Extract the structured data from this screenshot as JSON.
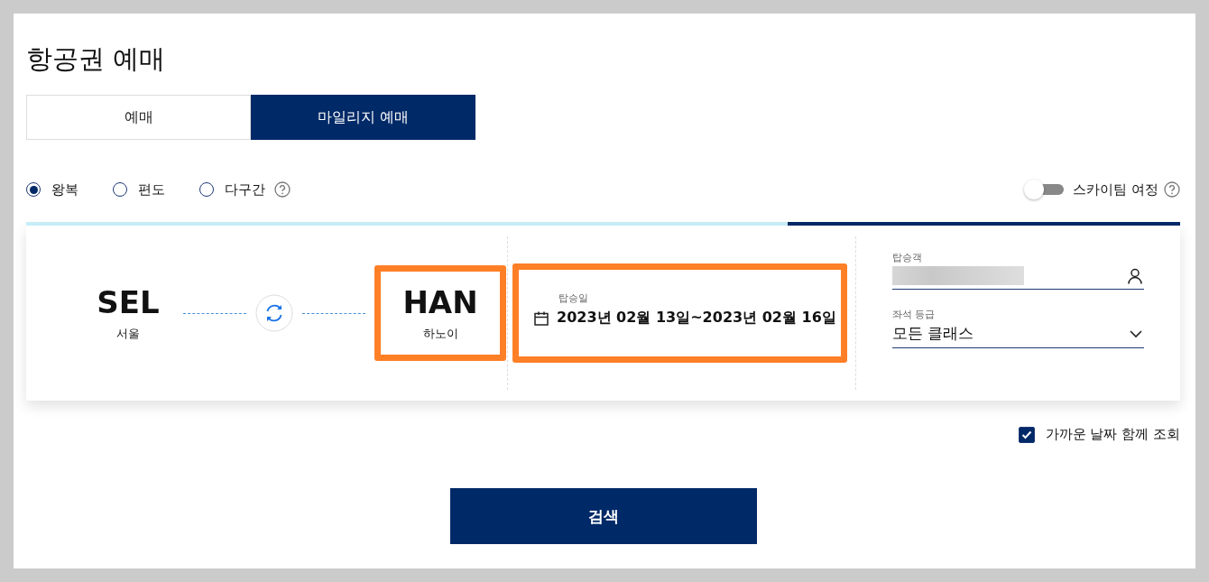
{
  "title": "항공권 예매",
  "tabs": [
    {
      "label": "예매",
      "selected": false
    },
    {
      "label": "마일리지 예매",
      "selected": true
    }
  ],
  "trip_types": [
    {
      "label": "왕복",
      "selected": true,
      "help": false
    },
    {
      "label": "편도",
      "selected": false,
      "help": false
    },
    {
      "label": "다구간",
      "selected": false,
      "help": true
    }
  ],
  "progress": {
    "level": 0.34
  },
  "skyteam_toggle": {
    "label": "스카이팀 여정",
    "on": false
  },
  "route": {
    "origin": {
      "code": "SEL",
      "city": "서울",
      "highlighted": false
    },
    "destination": {
      "code": "HAN",
      "city": "하노이",
      "highlighted": true
    }
  },
  "dates": {
    "label": "탑승일",
    "value": "2023년 02월 13일~2023년 02월 16일",
    "highlighted": true
  },
  "passengers": {
    "label": "탑승객",
    "kind": "redacted"
  },
  "seat_class": {
    "label": "좌석 등급",
    "value": "모든 클래스"
  },
  "nearby_dates": {
    "label": "가까운 날짜 함께 조회",
    "checked": true
  },
  "search_button": "검색"
}
